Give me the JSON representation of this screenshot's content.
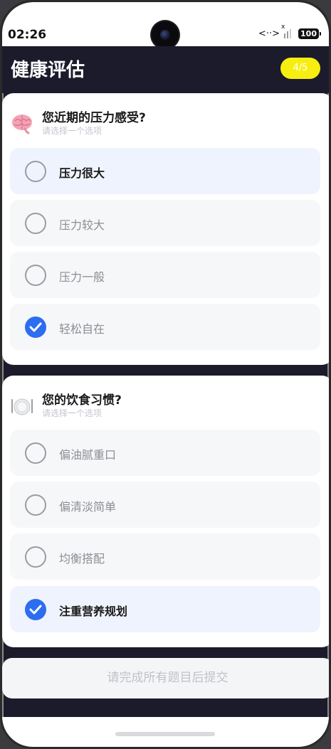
{
  "status": {
    "time": "02:26",
    "battery": "100",
    "network_symbol": "<··>"
  },
  "app": {
    "title": "健康评估",
    "progress": "4/5",
    "accent_color": "#2d6df0",
    "badge_color": "#f7ee11",
    "header_color": "#1b1b2b"
  },
  "questions": [
    {
      "icon": "brain-icon",
      "title": "您近期的压力感受?",
      "hint": "请选择一个选项",
      "options": [
        {
          "label": "压力很大",
          "selected": false
        },
        {
          "label": "压力较大",
          "selected": false
        },
        {
          "label": "压力一般",
          "selected": false
        },
        {
          "label": "轻松自在",
          "selected": true
        }
      ]
    },
    {
      "icon": "plate-cutlery-icon",
      "title": "您的饮食习惯?",
      "hint": "请选择一个选项",
      "options": [
        {
          "label": "偏油腻重口",
          "selected": false
        },
        {
          "label": "偏清淡简单",
          "selected": false
        },
        {
          "label": "均衡搭配",
          "selected": false
        },
        {
          "label": "注重营养规划",
          "selected": true
        }
      ]
    }
  ],
  "submit": {
    "label": "请完成所有题目后提交",
    "enabled": false
  }
}
